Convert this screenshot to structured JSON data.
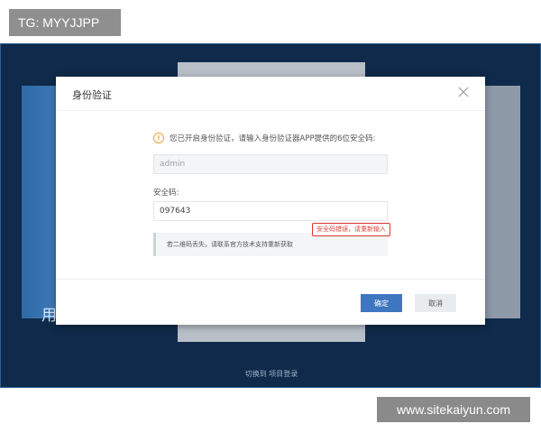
{
  "overlays": {
    "top_label": "TG: MYYJJPP",
    "bottom_label": "www.sitekaiyun.com"
  },
  "background": {
    "left_panel_text": "用",
    "bottom_link": "切换到 项目登录"
  },
  "modal": {
    "title": "身份验证",
    "notice": "您已开启身份验证，请输入身份验证器APP提供的6位安全码:",
    "username_value": "admin",
    "code_label": "安全码:",
    "code_value": "097643",
    "error_message": "安全码错误，请重新输入",
    "qr_note": "若二维码丢失，请联系官方技术支持重新获取",
    "confirm_label": "确定",
    "cancel_label": "取消"
  },
  "icons": {
    "warning": "warning-icon",
    "close": "close-icon"
  },
  "colors": {
    "accent": "#3f76c0",
    "error": "#d9362b",
    "warning": "#f0a030",
    "screen_bg": "#0f2a4a"
  }
}
